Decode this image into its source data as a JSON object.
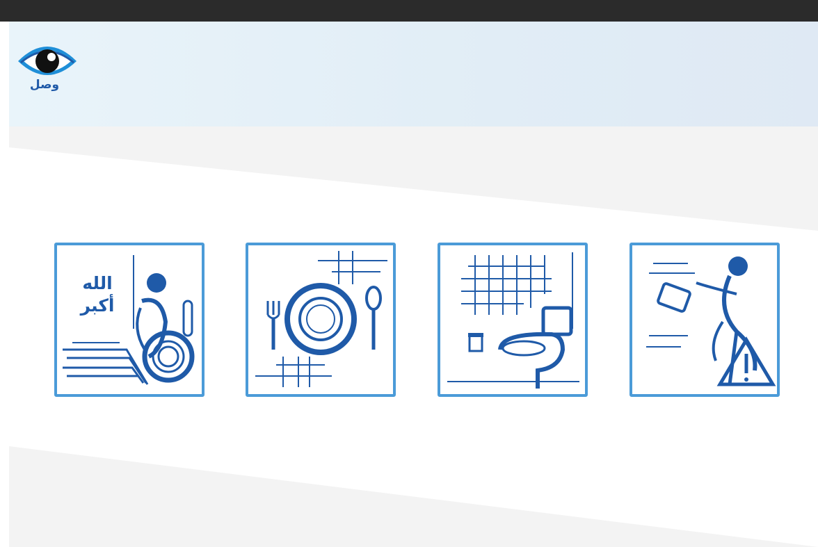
{
  "app": {
    "logo_text": "وصل"
  },
  "tiles": [
    {
      "name": "prayer",
      "text_line1": "الله",
      "text_line2": "أكبر"
    },
    {
      "name": "food"
    },
    {
      "name": "toilet"
    },
    {
      "name": "emergency"
    }
  ],
  "colors": {
    "accent": "#4b9bd8",
    "icon": "#1f5aa8",
    "header_bg": "#e4eff7",
    "topbar": "#2b2b2b"
  }
}
